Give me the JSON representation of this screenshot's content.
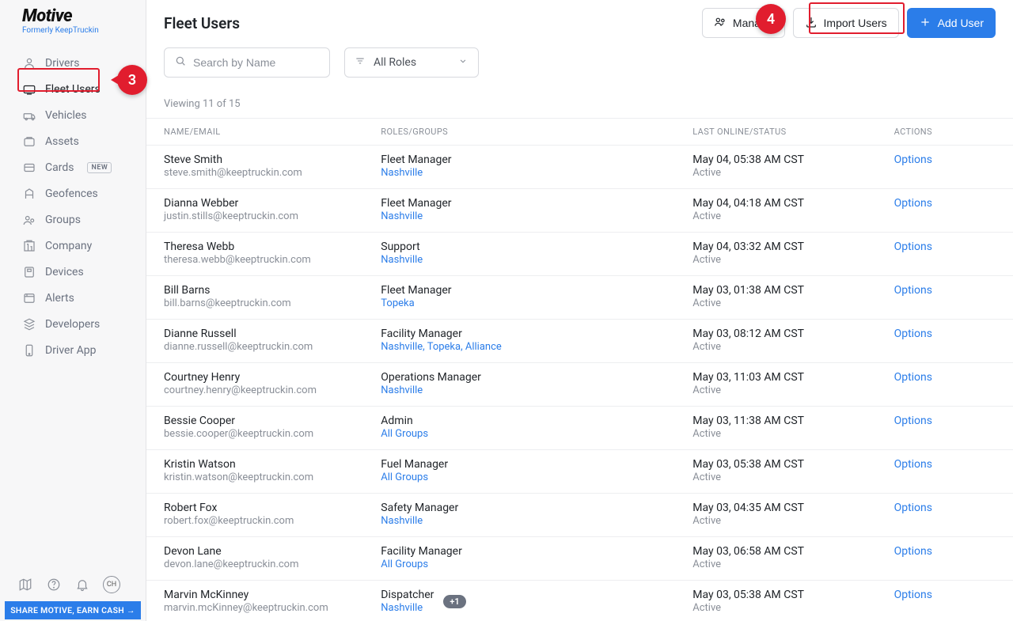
{
  "brand": {
    "name": "Motive",
    "tagline": "Formerly KeepTruckin"
  },
  "nav": {
    "items": [
      {
        "label": "Drivers"
      },
      {
        "label": "Fleet Users"
      },
      {
        "label": "Vehicles"
      },
      {
        "label": "Assets"
      },
      {
        "label": "Cards",
        "badge": "NEW"
      },
      {
        "label": "Geofences"
      },
      {
        "label": "Groups"
      },
      {
        "label": "Company"
      },
      {
        "label": "Devices"
      },
      {
        "label": "Alerts"
      },
      {
        "label": "Developers"
      },
      {
        "label": "Driver App"
      }
    ],
    "share": "SHARE MOTIVE, EARN CASH →",
    "avatar": "CH"
  },
  "callouts": {
    "c3": "3",
    "c4": "4"
  },
  "page": {
    "title": "Fleet Users",
    "manage": "Manage",
    "import": "Import Users",
    "add": "Add User",
    "search_placeholder": "Search by Name",
    "roles_filter": "All Roles",
    "viewing": "Viewing 11 of 15",
    "options": "Options",
    "cols": {
      "name": "NAME/EMAIL",
      "roles": "ROLES/GROUPS",
      "status": "LAST ONLINE/STATUS",
      "actions": "ACTIONS"
    }
  },
  "users": [
    {
      "name": "Steve Smith",
      "email": "steve.smith@keeptruckin.com",
      "role": "Fleet Manager",
      "groups": "Nashville",
      "time": "May 04, 05:38 AM CST",
      "status": "Active"
    },
    {
      "name": "Dianna Webber",
      "email": "justin.stills@keeptruckin.com",
      "role": "Fleet Manager",
      "groups": "Nashville",
      "time": "May 04, 04:18 AM CST",
      "status": "Active"
    },
    {
      "name": "Theresa Webb",
      "email": "theresa.webb@keeptruckin.com",
      "role": "Support",
      "groups": "Nashville",
      "time": "May 04, 03:32 AM CST",
      "status": "Active"
    },
    {
      "name": "Bill Barns",
      "email": "bill.barns@keeptruckin.com",
      "role": "Fleet Manager",
      "groups": "Topeka",
      "time": "May 03, 01:38 AM CST",
      "status": "Active"
    },
    {
      "name": "Dianne Russell",
      "email": "dianne.russell@keeptruckin.com",
      "role": "Facility Manager",
      "groups": "Nashville, Topeka, Alliance",
      "time": "May 03, 08:12 AM CST",
      "status": "Active"
    },
    {
      "name": "Courtney Henry",
      "email": "courtney.henry@keeptruckin.com",
      "role": "Operations Manager",
      "groups": "Nashville",
      "time": "May 03, 11:03 AM CST",
      "status": "Active"
    },
    {
      "name": "Bessie Cooper",
      "email": "bessie.cooper@keeptruckin.com",
      "role": "Admin",
      "groups": "All Groups",
      "time": "May 03, 11:38 AM CST",
      "status": "Active"
    },
    {
      "name": "Kristin Watson",
      "email": "kristin.watson@keeptruckin.com",
      "role": "Fuel Manager",
      "groups": "All Groups",
      "time": "May 03, 05:38 AM CST",
      "status": "Active"
    },
    {
      "name": "Robert Fox",
      "email": "robert.fox@keeptruckin.com",
      "role": "Safety Manager",
      "groups": "Nashville",
      "time": "May 03, 04:35 AM CST",
      "status": "Active"
    },
    {
      "name": "Devon Lane",
      "email": "devon.lane@keeptruckin.com",
      "role": "Facility Manager",
      "groups": "All Groups",
      "time": "May 03, 06:58 AM CST",
      "status": "Active"
    },
    {
      "name": "Marvin McKinney",
      "email": "marvin.mcKinney@keeptruckin.com",
      "role": "Dispatcher",
      "groups": "Nashville",
      "time": "May 03, 05:38 AM CST",
      "status": "Active",
      "extra": "+1"
    }
  ]
}
